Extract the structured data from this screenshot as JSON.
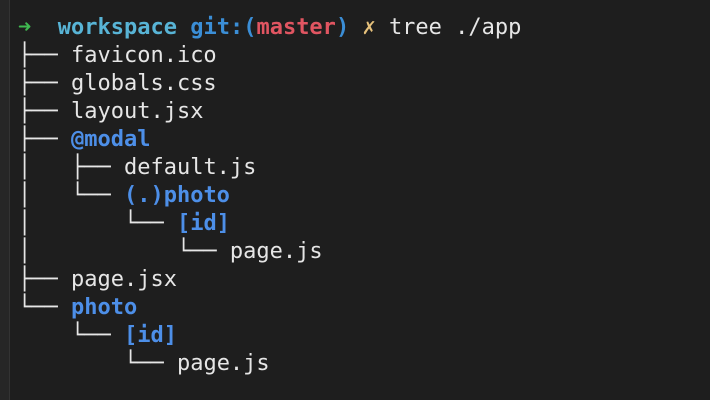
{
  "prompt": {
    "arrow": "➜",
    "directory": "workspace",
    "git_label": "git:",
    "branch_open": "(",
    "branch": "master",
    "branch_close": ")",
    "dirty_marker": "✗",
    "command": "tree ./app"
  },
  "tree": [
    {
      "prefix": "├── ",
      "name": "favicon.ico",
      "kind": "file"
    },
    {
      "prefix": "├── ",
      "name": "globals.css",
      "kind": "file"
    },
    {
      "prefix": "├── ",
      "name": "layout.jsx",
      "kind": "file"
    },
    {
      "prefix": "├── ",
      "name": "@modal",
      "kind": "folder"
    },
    {
      "prefix": "│   ├── ",
      "name": "default.js",
      "kind": "file"
    },
    {
      "prefix": "│   └── ",
      "name": "(.)photo",
      "kind": "folder"
    },
    {
      "prefix": "│       └── ",
      "name": "[id]",
      "kind": "folder"
    },
    {
      "prefix": "│           └── ",
      "name": "page.js",
      "kind": "file"
    },
    {
      "prefix": "├── ",
      "name": "page.jsx",
      "kind": "file"
    },
    {
      "prefix": "└── ",
      "name": "photo",
      "kind": "folder"
    },
    {
      "prefix": "    └── ",
      "name": "[id]",
      "kind": "folder"
    },
    {
      "prefix": "        └── ",
      "name": "page.js",
      "kind": "file"
    }
  ],
  "colors": {
    "background": "#1e1e1e",
    "arrow": "#3fb950",
    "directory": "#58b4d6",
    "git": "#3b8ed6",
    "branch": "#e05561",
    "dirty": "#e5c07b",
    "folder": "#4d8fe8",
    "text": "#e6e6e6"
  }
}
